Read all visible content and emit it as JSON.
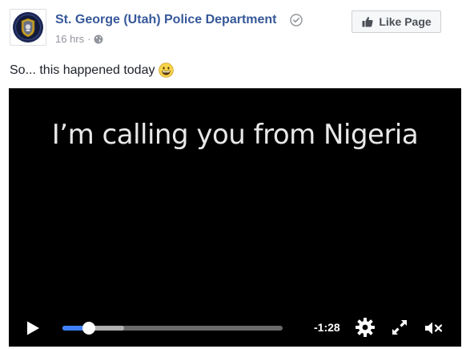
{
  "post": {
    "page_name": "St. George (Utah) Police Department",
    "time_ago": "16 hrs",
    "separator": "·",
    "text": "So... this happened today",
    "icons": {
      "avatar": "police-badge-logo",
      "verified": "check-circle-icon",
      "audience": "globe-icon",
      "emoji": "grinning-face-emoji"
    }
  },
  "like_button": {
    "label": "Like Page",
    "icon": "thumbs-up-icon"
  },
  "video": {
    "caption": "I’m calling you from Nigeria",
    "time_remaining": "-1:28",
    "progress": {
      "played_fraction": 0.12,
      "buffered_fraction": 0.28
    },
    "controls": {
      "play_icon": "play-icon",
      "settings_icon": "gear-icon",
      "fullscreen_icon": "expand-icon",
      "volume_icon": "muted-speaker-icon"
    }
  },
  "colors": {
    "page_name": "#365899",
    "meta_text": "#90949c",
    "progress_played": "#4080ff",
    "video_bg": "#000000"
  }
}
